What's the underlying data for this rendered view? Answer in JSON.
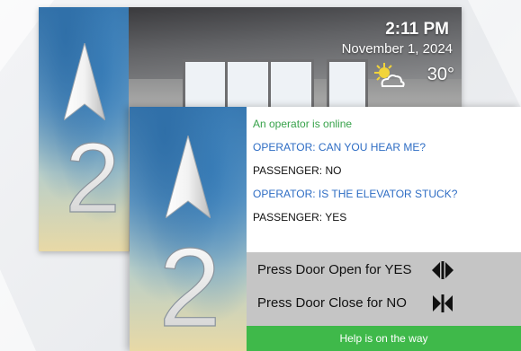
{
  "back_screen": {
    "floor_number": "2",
    "time": "2:11 PM",
    "date": "November 1, 2024",
    "temperature": "30°",
    "weather_icon": "partly-sunny-icon",
    "direction_icon": "up-arrow-icon"
  },
  "front_screen": {
    "floor_number": "2",
    "direction_icon": "up-arrow-icon",
    "chat": [
      {
        "text": "An operator is online",
        "color": "#37a24a"
      },
      {
        "text": "OPERATOR: CAN YOU HEAR ME?",
        "color": "#2e6dc4"
      },
      {
        "text": "PASSENGER: NO",
        "color": "#111111"
      },
      {
        "text": "OPERATOR: IS THE ELEVATOR STUCK?",
        "color": "#2e6dc4"
      },
      {
        "text": "PASSENGER: YES",
        "color": "#111111"
      }
    ],
    "instructions": {
      "yes": "Press Door Open for YES",
      "yes_icon": "door-open-icon",
      "no": "Press Door Close for NO",
      "no_icon": "door-close-icon"
    },
    "status_bar": "Help is on the way"
  },
  "colors": {
    "status_green": "#3fb94a",
    "instruction_gray": "#c5c5c5",
    "operator_blue": "#2e6dc4",
    "online_green": "#37a24a"
  }
}
